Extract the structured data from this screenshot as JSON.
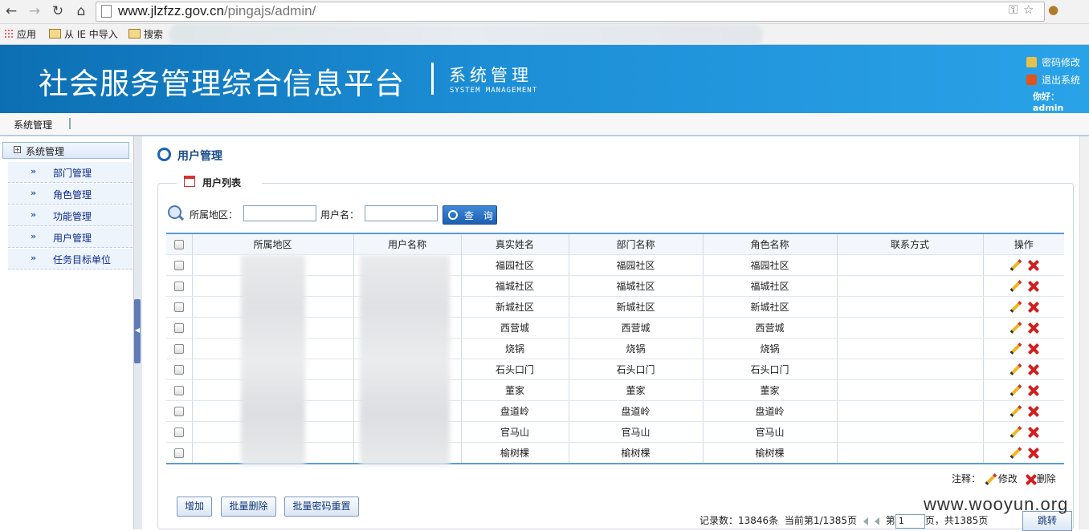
{
  "browser": {
    "url_host": "www.jlzfzz.gov.cn",
    "url_path": "/pingajs/admin/",
    "bookmarks": [
      "应用",
      "从 IE 中导入",
      "搜索"
    ]
  },
  "header": {
    "title": "社会服务管理综合信息平台",
    "subtitle": "系统管理",
    "subtitle_en": "SYSTEM MANAGEMENT",
    "links": [
      "密码修改",
      "退出系统"
    ],
    "greeting": "你好：admin"
  },
  "menubar": {
    "item": "系统管理"
  },
  "sidebar": {
    "header": "系统管理",
    "items": [
      {
        "label": "部门管理"
      },
      {
        "label": "角色管理"
      },
      {
        "label": "功能管理"
      },
      {
        "label": "用户管理"
      },
      {
        "label": "任务目标单位"
      }
    ]
  },
  "main": {
    "title": "用户管理",
    "section": "用户列表",
    "search": {
      "area_label": "所属地区：",
      "user_label": "用户名：",
      "area_value": "",
      "user_value": "",
      "button": "查 询"
    },
    "columns": [
      "所属地区",
      "用户名称",
      "真实姓名",
      "部门名称",
      "角色名称",
      "联系方式",
      "操作"
    ],
    "rows": [
      {
        "real": "福园社区",
        "dept": "福园社区",
        "role": "福园社区"
      },
      {
        "real": "福城社区",
        "dept": "福城社区",
        "role": "福城社区"
      },
      {
        "real": "新城社区",
        "dept": "新城社区",
        "role": "新城社区"
      },
      {
        "real": "西营城",
        "dept": "西营城",
        "role": "西营城"
      },
      {
        "real": "烧锅",
        "dept": "烧锅",
        "role": "烧锅"
      },
      {
        "real": "石头口门",
        "dept": "石头口门",
        "role": "石头口门"
      },
      {
        "real": "董家",
        "dept": "董家",
        "role": "董家"
      },
      {
        "real": "盘道岭",
        "dept": "盘道岭",
        "role": "盘道岭"
      },
      {
        "real": "官马山",
        "dept": "官马山",
        "role": "官马山"
      },
      {
        "real": "榆树棵",
        "dept": "榆树棵",
        "role": "榆树棵"
      }
    ],
    "note": {
      "label": "注释：",
      "edit": "修改",
      "delete": "删除"
    },
    "buttons": [
      "增加",
      "批量删除",
      "批量密码重置"
    ],
    "pager": {
      "records": "记录数：13846条",
      "current": "当前第1/1385页",
      "page_prefix": "第",
      "page_value": "1",
      "page_suffix": "页，共1385页",
      "go": "跳转"
    }
  },
  "watermark": "www.wooyun.org"
}
